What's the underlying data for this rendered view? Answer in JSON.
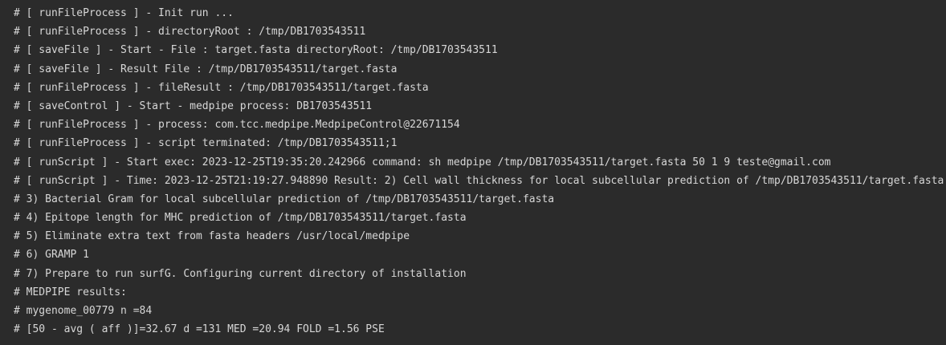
{
  "colors": {
    "background": "#2b2b2b",
    "text": "#d7d7d7"
  },
  "terminal": {
    "lines": [
      "# [ runFileProcess ] - Init run ...",
      "# [ runFileProcess ] - directoryRoot : /tmp/DB1703543511",
      "# [ saveFile ] - Start - File : target.fasta directoryRoot: /tmp/DB1703543511",
      "# [ saveFile ] - Result File : /tmp/DB1703543511/target.fasta",
      "# [ runFileProcess ] - fileResult : /tmp/DB1703543511/target.fasta",
      "# [ saveControl ] - Start - medpipe process: DB1703543511",
      "# [ runFileProcess ] - process: com.tcc.medpipe.MedpipeControl@22671154",
      "# [ runFileProcess ] - script terminated: /tmp/DB1703543511;1",
      "# [ runScript ] - Start exec: 2023-12-25T19:35:20.242966 command: sh medpipe /tmp/DB1703543511/target.fasta 50 1 9 teste@gmail.com",
      "# [ runScript ] - Time: 2023-12-25T21:19:27.948890 Result: 2) Cell wall thickness for local subcellular prediction of /tmp/DB1703543511/target.fasta",
      "# 3) Bacterial Gram for local subcellular prediction of /tmp/DB1703543511/target.fasta",
      "# 4) Epitope length for MHC prediction of /tmp/DB1703543511/target.fasta",
      "# 5) Eliminate extra text from fasta headers /usr/local/medpipe",
      "# 6) GRAMP 1",
      "# 7) Prepare to run surfG. Configuring current directory of installation",
      "# MEDPIPE results:",
      "# mygenome_00779 n =84",
      "# [50 - avg ( aff )]=32.67 d =131 MED =20.94 FOLD =1.56 PSE"
    ]
  }
}
